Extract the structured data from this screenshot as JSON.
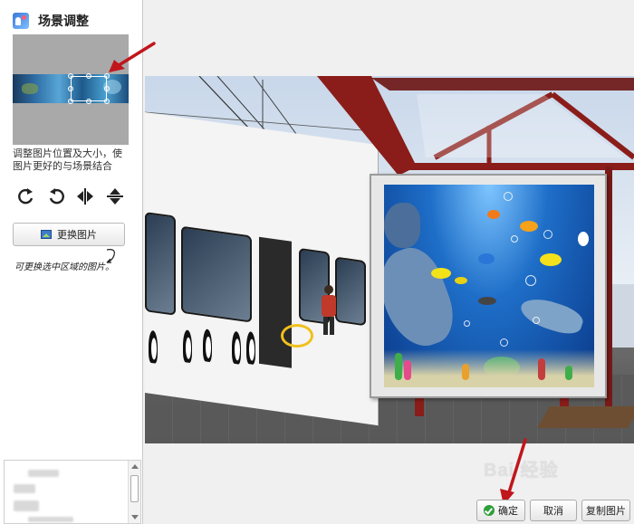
{
  "panel": {
    "title": "场景调整",
    "hint": "调整图片位置及大小，使图片更好的与场景结合",
    "change_image_label": "更换图片",
    "handwritten_note": "可更换选中区域的图片。"
  },
  "tools": {
    "rotate_left": "rotate-left-icon",
    "rotate_right": "rotate-right-icon",
    "flip_horizontal": "flip-horizontal-icon",
    "flip_vertical": "flip-vertical-icon"
  },
  "watermark": {
    "text": "Bai 经验"
  },
  "buttons": {
    "ok": "确定",
    "cancel": "取消",
    "copy_image": "复制图片"
  },
  "colors": {
    "annotation_arrow": "#c0161c",
    "ok_icon": "#2f9e3b",
    "shelter_frame": "#8a1d19"
  }
}
